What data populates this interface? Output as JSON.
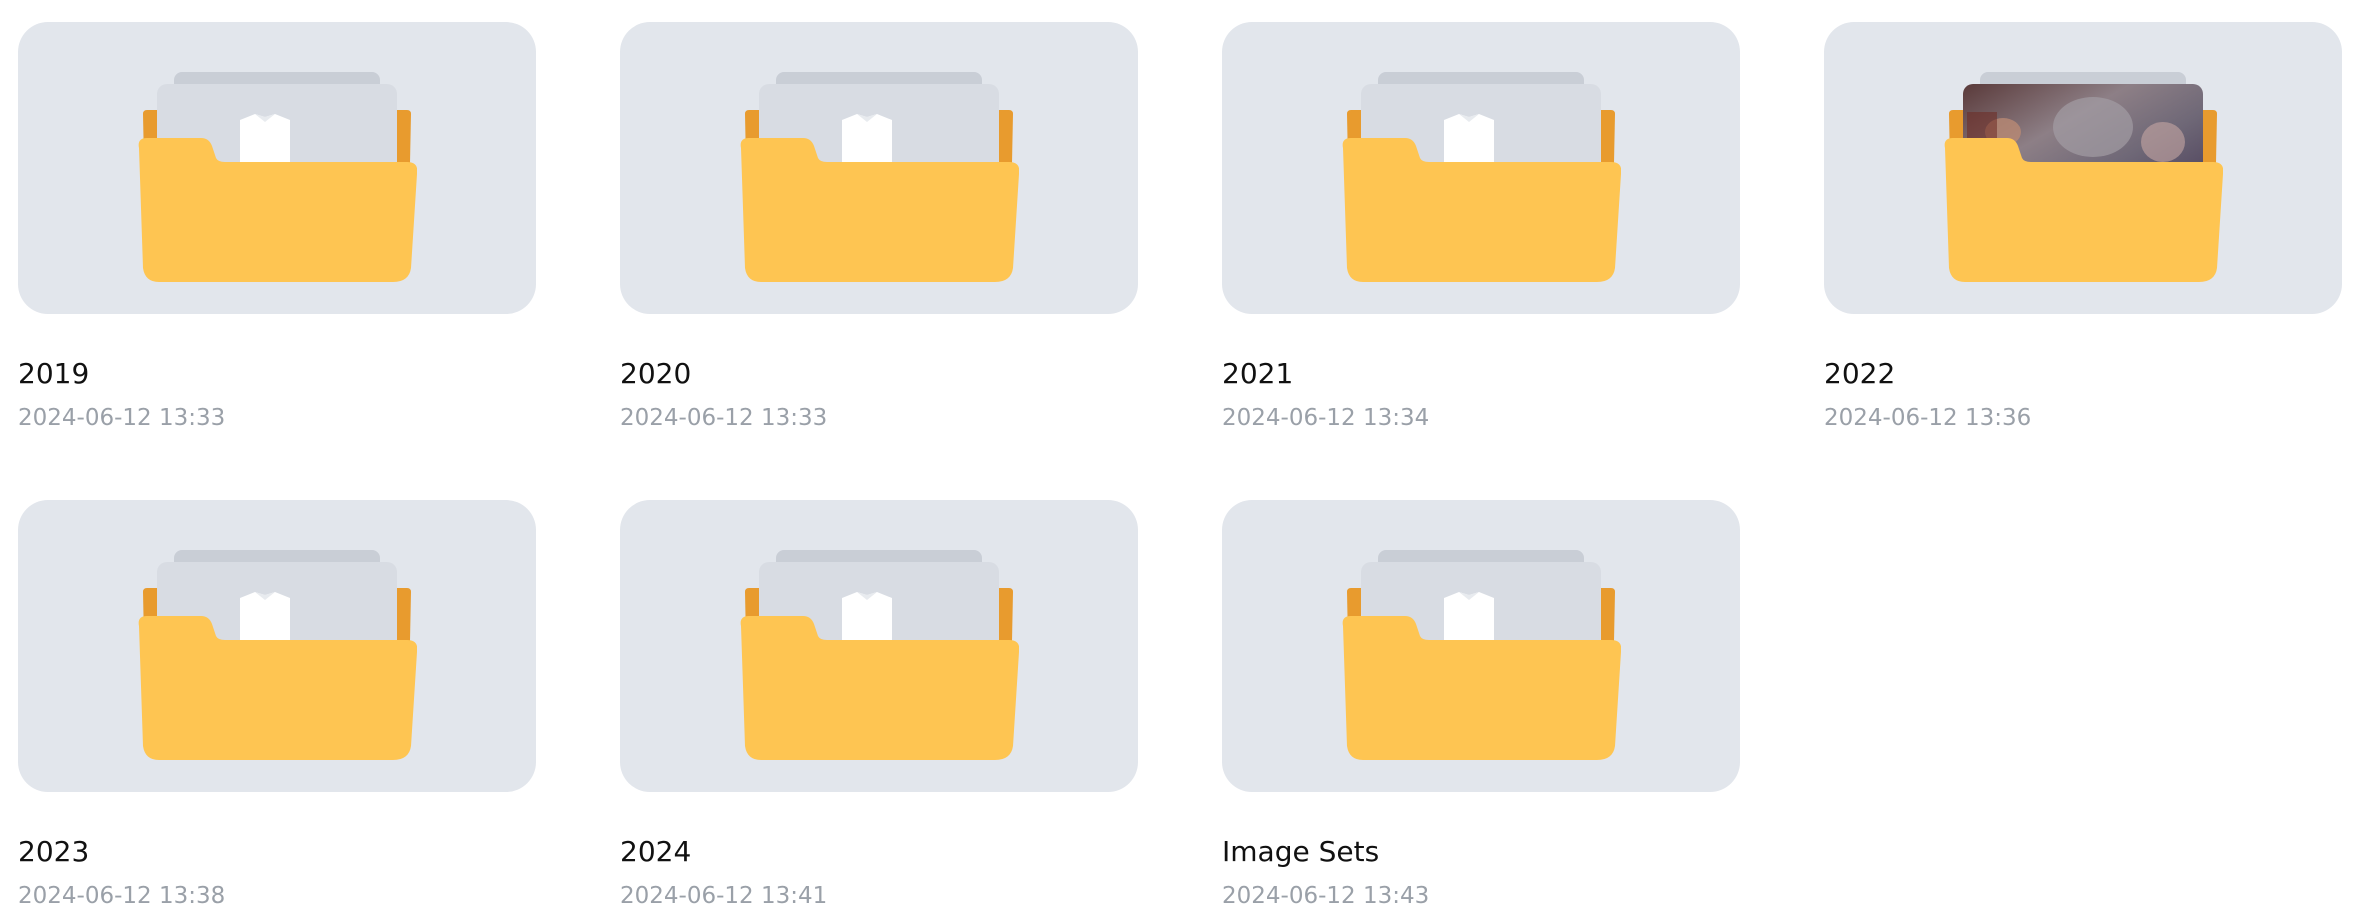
{
  "folders": [
    {
      "name": "2019",
      "date": "2024-06-12 13:33",
      "icon": "folder-icon",
      "has_photo_preview": false
    },
    {
      "name": "2020",
      "date": "2024-06-12 13:33",
      "icon": "folder-icon",
      "has_photo_preview": false
    },
    {
      "name": "2021",
      "date": "2024-06-12 13:34",
      "icon": "folder-icon",
      "has_photo_preview": false
    },
    {
      "name": "2022",
      "date": "2024-06-12 13:36",
      "icon": "folder-icon",
      "has_photo_preview": true
    },
    {
      "name": "2023",
      "date": "2024-06-12 13:38",
      "icon": "folder-icon",
      "has_photo_preview": false
    },
    {
      "name": "2024",
      "date": "2024-06-12 13:41",
      "icon": "folder-icon",
      "has_photo_preview": false
    },
    {
      "name": "Image Sets",
      "date": "2024-06-12 13:43",
      "icon": "folder-icon",
      "has_photo_preview": false
    }
  ],
  "colors": {
    "tile_background": "#e2e6ec",
    "folder_front": "#fec552",
    "folder_back": "#e89b2e",
    "paper": "#d8dce3",
    "paper_back": "#c9ced6",
    "document": "#ffffff",
    "name_text": "#111111",
    "date_text": "#9aa0a8"
  }
}
